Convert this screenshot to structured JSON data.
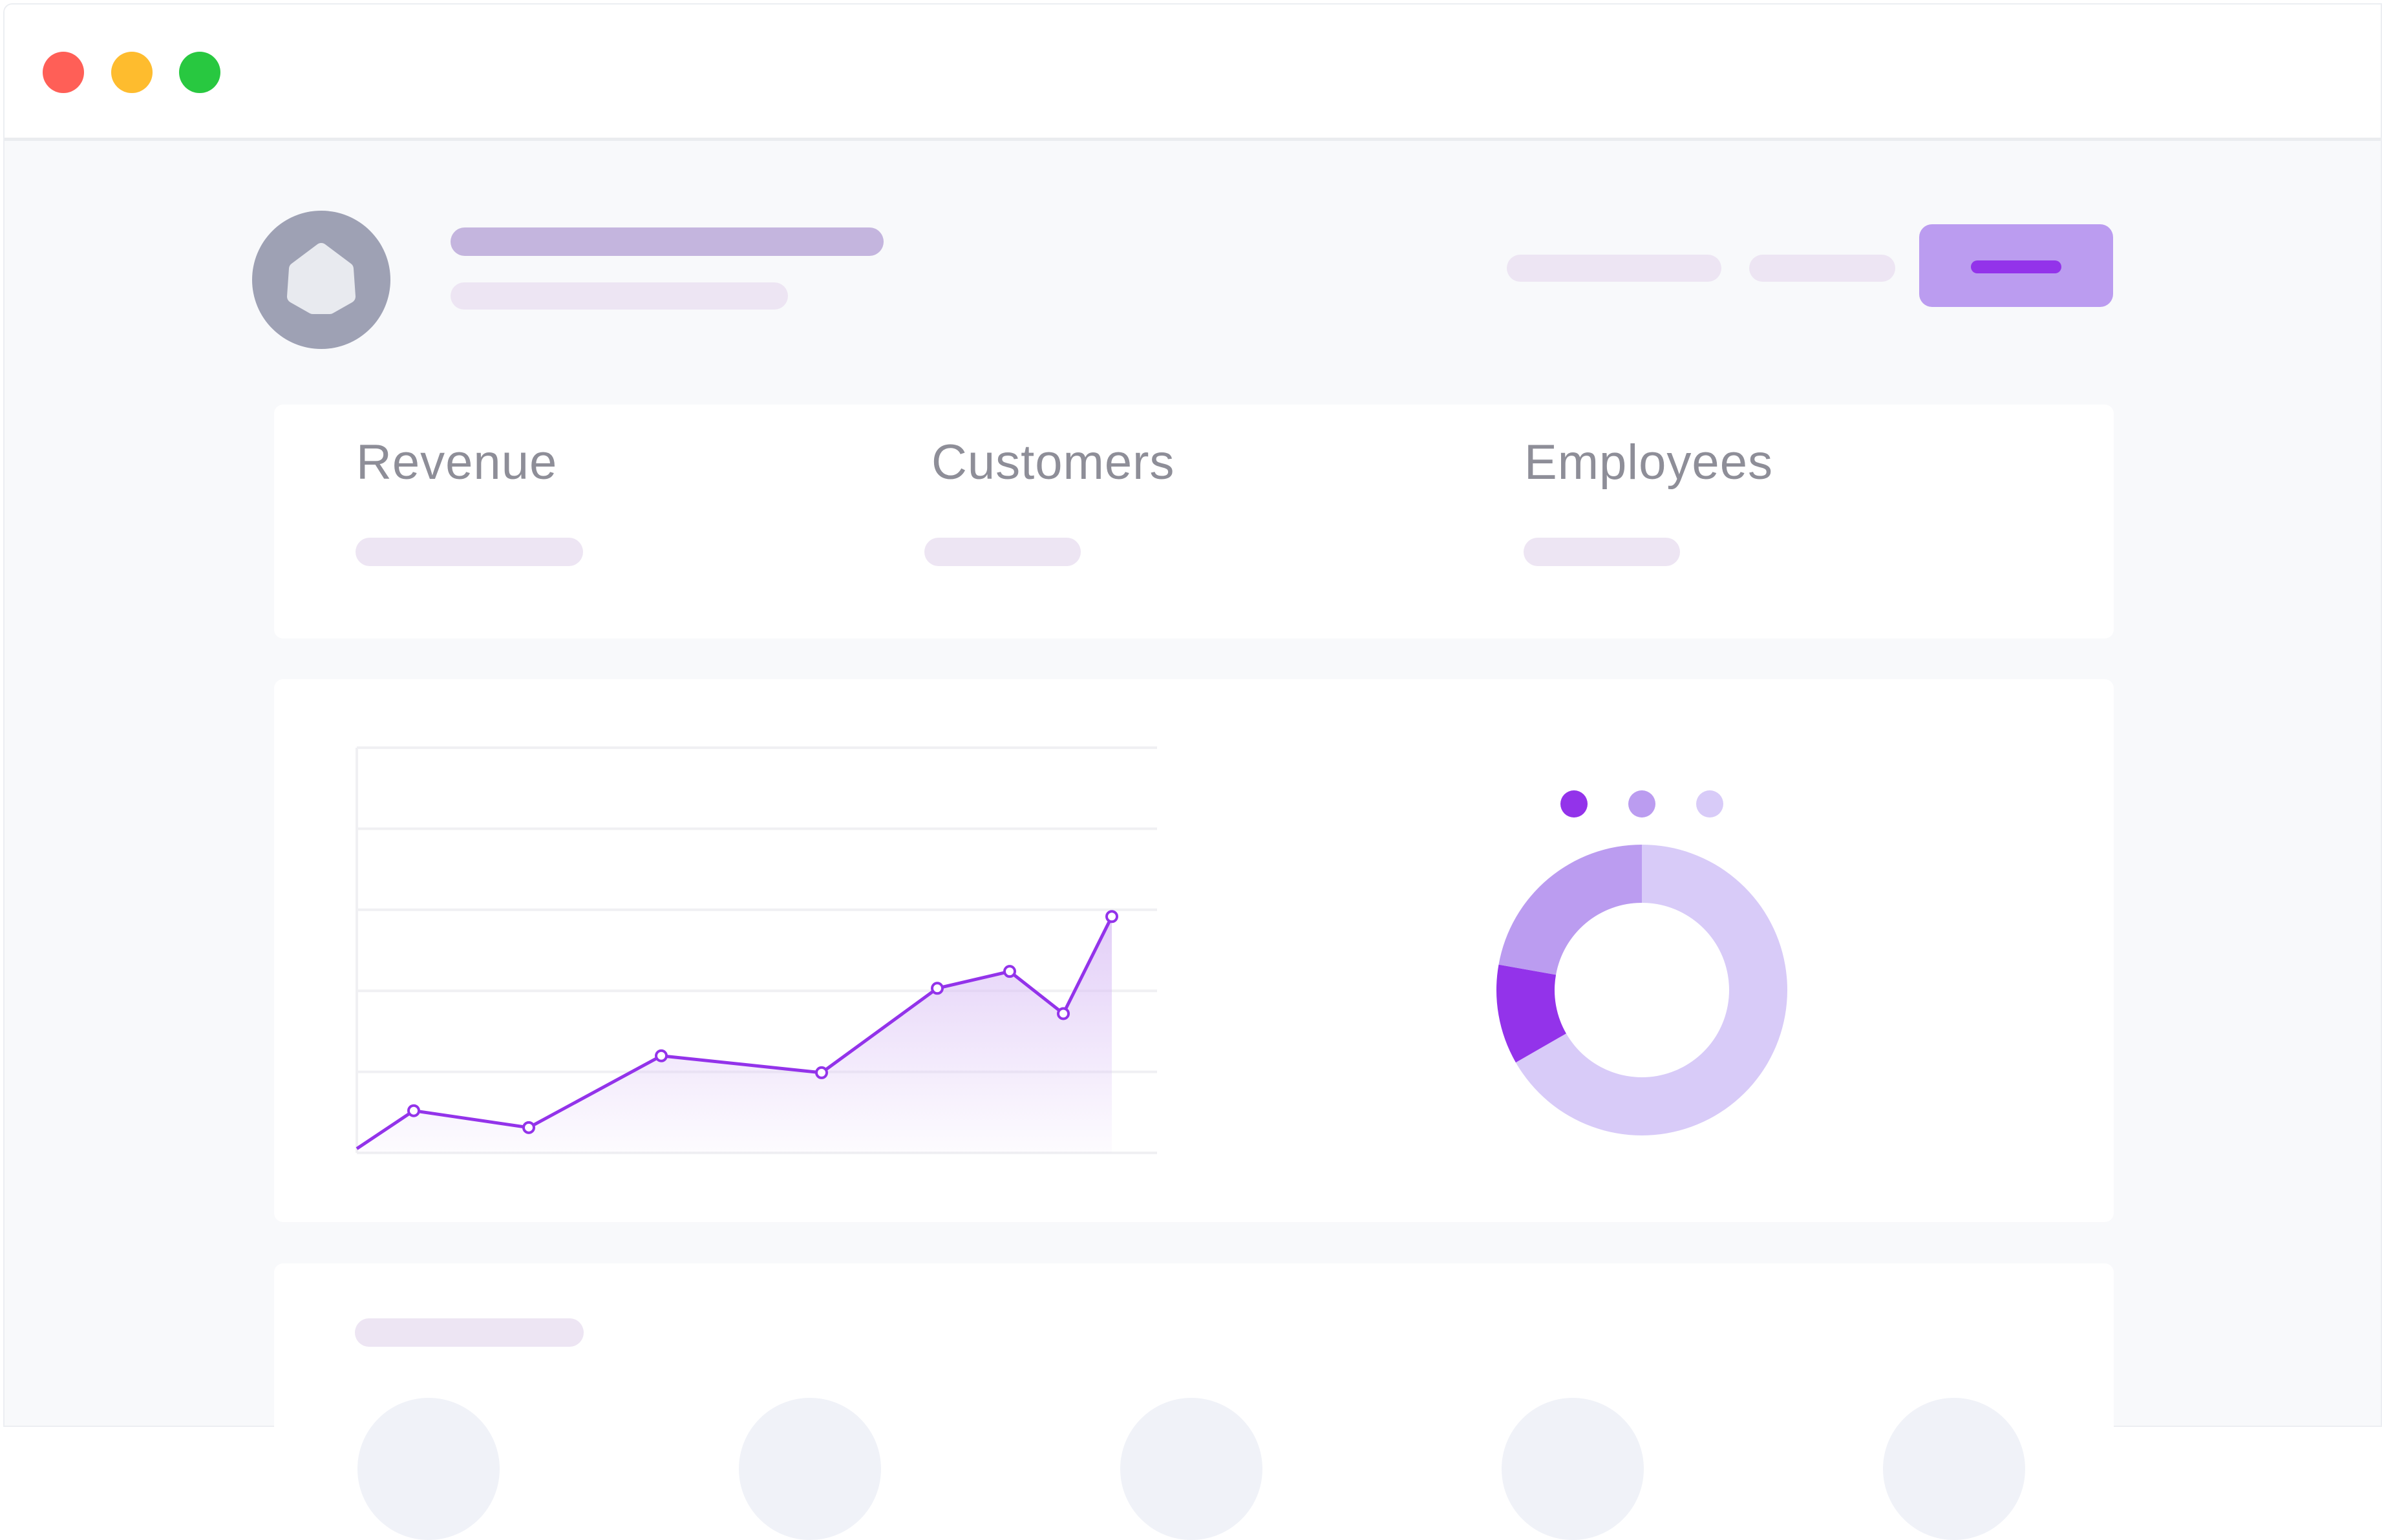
{
  "window": {
    "traffic_lights": [
      {
        "name": "close",
        "color": "#ff5f57"
      },
      {
        "name": "minimize",
        "color": "#febc2e"
      },
      {
        "name": "zoom",
        "color": "#28c840"
      }
    ]
  },
  "header": {
    "avatar_icon": "pentagon-logo-icon",
    "primary_color": "#9333ea",
    "accent_color": "#bb9cf0"
  },
  "stats": {
    "revenue_label": "Revenue",
    "customers_label": "Customers",
    "employees_label": "Employees"
  },
  "chart_data": [
    {
      "type": "area",
      "title": "",
      "xlabel": "",
      "ylabel": "",
      "grid": true,
      "x": [
        0,
        1,
        2,
        3,
        4,
        5,
        6,
        7,
        8,
        9
      ],
      "series": [
        {
          "values": [
            5,
            14,
            10,
            27,
            23,
            43,
            47,
            37,
            60
          ],
          "color": "#9333ea"
        }
      ],
      "ylim": [
        4,
        100
      ]
    },
    {
      "type": "pie",
      "title": "",
      "donut": true,
      "slices": [
        {
          "value": 66.7,
          "color": "#d8cbf8"
        },
        {
          "value": 11.1,
          "color": "#9333ea"
        },
        {
          "value": 22.2,
          "color": "#bb9cf0"
        }
      ],
      "legend": [
        "#9333ea",
        "#bb9cf0",
        "#d8cbf8"
      ]
    }
  ]
}
